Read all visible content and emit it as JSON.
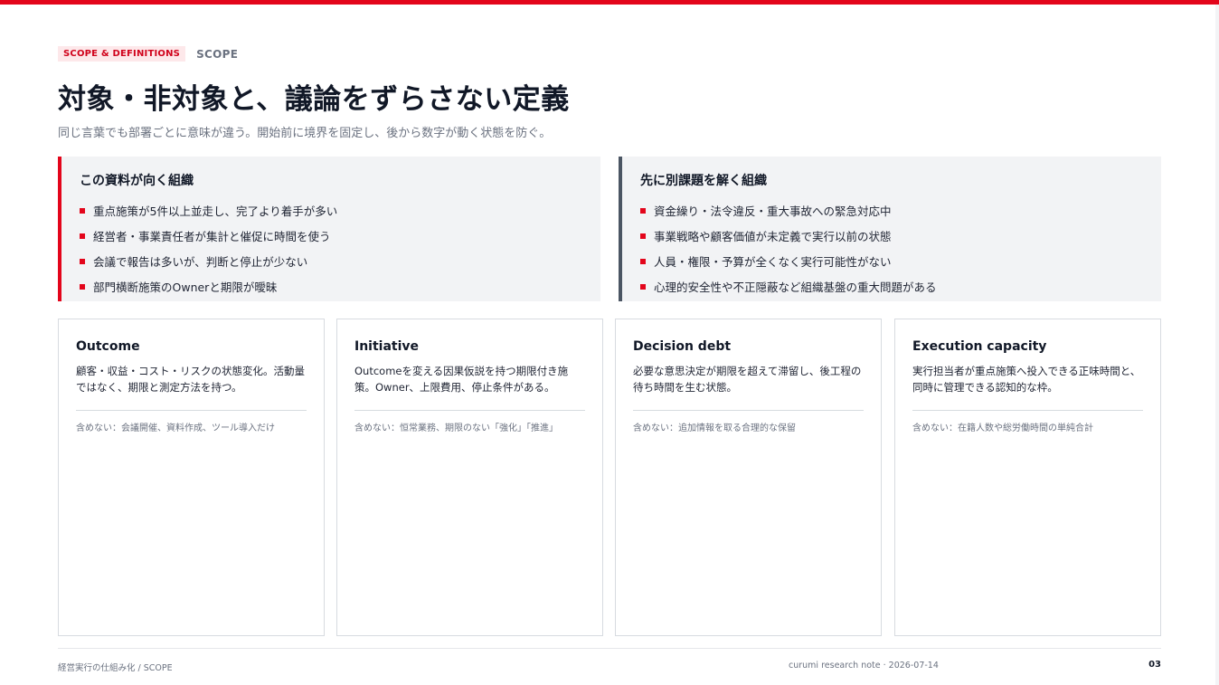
{
  "header": {
    "tag": "SCOPE & DEFINITIONS",
    "section": "SCOPE",
    "title": "対象・非対象と、議論をずらさない定義",
    "subtitle": "同じ言葉でも部署ごとに意味が違う。開始前に境界を固定し、後から数字が動く状態を防ぐ。",
    "accent_color": "#e3051b"
  },
  "panels": {
    "fit": {
      "heading": "この資料が向く組織",
      "items": [
        "重点施策が5件以上並走し、完了より着手が多い",
        "経営者・事業責任者が集計と催促に時間を使う",
        "会議で報告は多いが、判断と停止が少ない",
        "部門横断施策のOwnerと期限が曖昧"
      ]
    },
    "unfit": {
      "heading": "先に別課題を解く組織",
      "items": [
        "資金繰り・法令違反・重大事故への緊急対応中",
        "事業戦略や顧客価値が未定義で実行以前の状態",
        "人員・権限・予算が全くなく実行可能性がない",
        "心理的安全性や不正隠蔽など組織基盤の重大問題がある"
      ]
    }
  },
  "cards": [
    {
      "term": "Outcome",
      "definition": "顧客・収益・コスト・リスクの状態変化。活動量ではなく、期限と測定方法を持つ。",
      "exclusion": "含めない：会議開催、資料作成、ツール導入だけ"
    },
    {
      "term": "Initiative",
      "definition": "Outcomeを変える因果仮説を持つ期限付き施策。Owner、上限費用、停止条件がある。",
      "exclusion": "含めない：恒常業務、期限のない「強化」「推進」"
    },
    {
      "term": "Decision debt",
      "definition": "必要な意思決定が期限を超えて滞留し、後工程の待ち時間を生む状態。",
      "exclusion": "含めない：追加情報を取る合理的な保留"
    },
    {
      "term": "Execution capacity",
      "definition": "実行担当者が重点施策へ投入できる正味時間と、同時に管理できる認知的な枠。",
      "exclusion": "含めない：在籍人数や総労働時間の単純合計"
    }
  ],
  "footer": {
    "left": "経営実行の仕組み化 / SCOPE",
    "center": "curumi research note · 2026-07-14",
    "page": "03"
  }
}
